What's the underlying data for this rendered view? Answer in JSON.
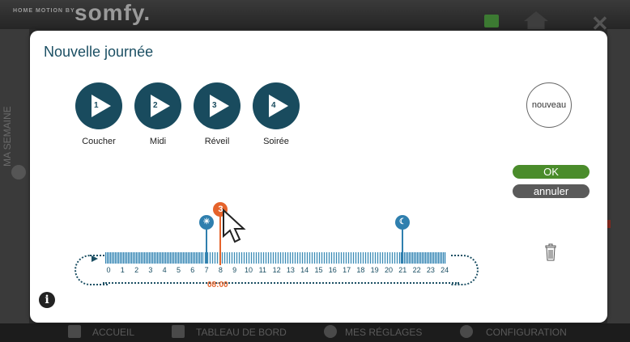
{
  "background": {
    "brand_small": "HOME MOTION BY",
    "brand_logo": "somfy.",
    "side_label": "MA SEMAINE",
    "nav": [
      {
        "label": "ACCUEIL",
        "icon": "home-icon"
      },
      {
        "label": "TABLEAU DE BORD",
        "icon": "dashboard-icon"
      },
      {
        "label": "MES RÉGLAGES",
        "icon": "user-icon"
      },
      {
        "label": "CONFIGURATION",
        "icon": "gear-icon"
      }
    ]
  },
  "modal": {
    "title": "Nouvelle journée",
    "scenes": [
      {
        "number": "1",
        "label": "Coucher"
      },
      {
        "number": "2",
        "label": "Midi"
      },
      {
        "number": "3",
        "label": "Réveil"
      },
      {
        "number": "4",
        "label": "Soirée"
      }
    ],
    "new_button": "nouveau",
    "ok_button": "OK",
    "cancel_button": "annuler",
    "info_icon": "i"
  },
  "timeline": {
    "hours": [
      "0",
      "1",
      "2",
      "3",
      "4",
      "5",
      "6",
      "7",
      "8",
      "9",
      "10",
      "11",
      "12",
      "13",
      "14",
      "15",
      "16",
      "17",
      "18",
      "19",
      "20",
      "21",
      "22",
      "23",
      "24"
    ],
    "markers": [
      {
        "type": "sunrise",
        "icon": "sunrise-icon",
        "hour": 7
      },
      {
        "type": "selected-scene",
        "label": "3",
        "hour": 8,
        "time": "08:00"
      },
      {
        "type": "night",
        "icon": "moon-icon",
        "hour": 21
      }
    ]
  },
  "colors": {
    "primary": "#194b5e",
    "ok": "#4a8c2b",
    "cancel": "#5a5a5a",
    "selected": "#e5632b",
    "marker": "#2f7fae"
  }
}
